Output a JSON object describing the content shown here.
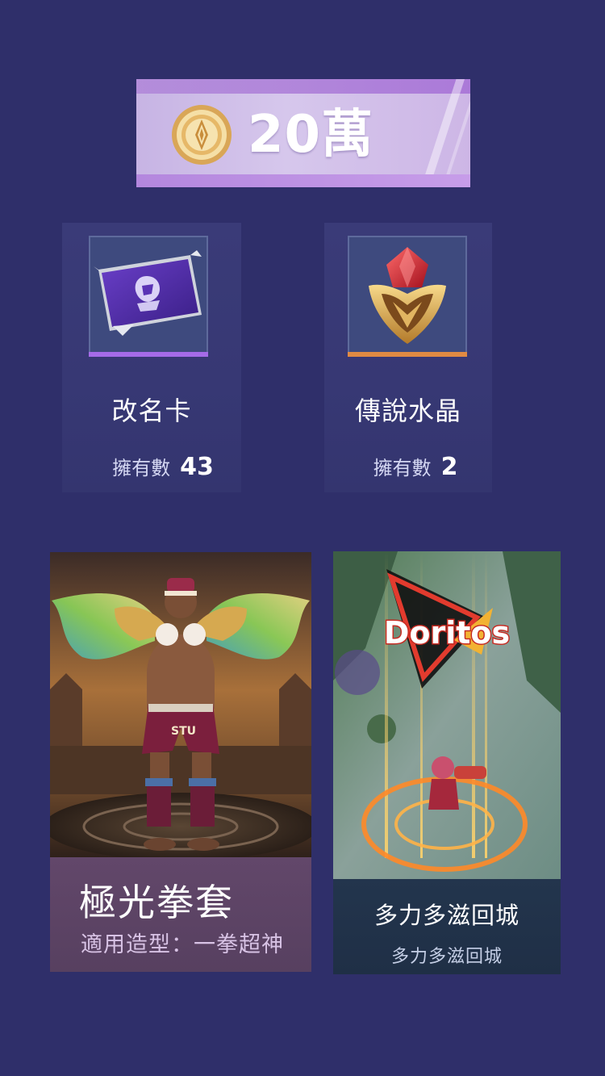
{
  "currency": {
    "amount": "20萬",
    "icon": "coin-icon"
  },
  "items": [
    {
      "name": "改名卡",
      "owned_label": "擁有數",
      "owned_count": "43",
      "icon": "rename-card-icon",
      "rarity_color": "#a56be8"
    },
    {
      "name": "傳說水晶",
      "owned_label": "擁有數",
      "owned_count": "2",
      "icon": "legend-crystal-icon",
      "rarity_color": "#e18a43"
    }
  ],
  "rewards": [
    {
      "title": "極光拳套",
      "subtitle": "適用造型：一拳超神",
      "image": "fighter-skin-art"
    },
    {
      "title": "多力多滋回城",
      "subtitle": "多力多滋回城",
      "image": "doritos-recall-art",
      "brand_text": "Doritos"
    }
  ]
}
